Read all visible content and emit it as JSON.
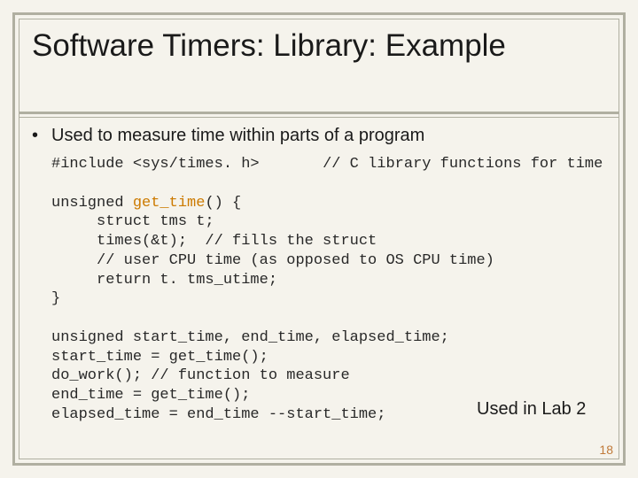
{
  "title": "Software Timers: Library: Example",
  "bullet": "Used to measure time within parts of a program",
  "code": {
    "l1a": "#include <sys/times. h>",
    "l1b": "// C library functions for time",
    "l2a": "unsigned ",
    "l2fn": "get_time",
    "l2b": "() {",
    "l3": "     struct tms t;",
    "l4": "     times(&t);  // fills the struct",
    "l5": "     // user CPU time (as opposed to OS CPU time)",
    "l6": "     return t. tms_utime;",
    "l7": "}",
    "l8": "unsigned start_time, end_time, elapsed_time;",
    "l9": "start_time = get_time();",
    "l10": "do_work(); // function to measure",
    "l11": "end_time = get_time();",
    "l12": "elapsed_time = end_time --start_time;"
  },
  "note": "Used in Lab 2",
  "page": "18"
}
